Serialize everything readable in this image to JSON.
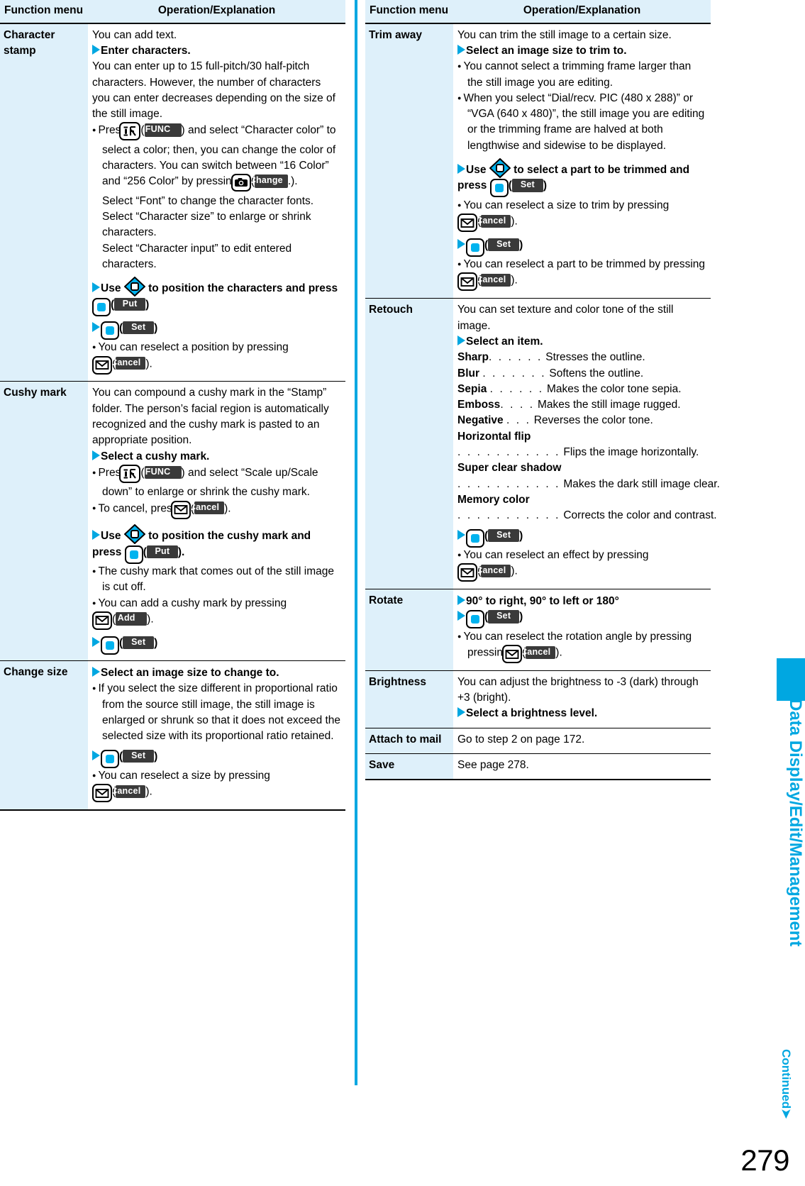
{
  "page": {
    "number": "279",
    "side_title": "Data Display/Edit/Management",
    "continued_label": "Continued",
    "continued_arrow": "➤",
    "accent_color": "#00a7e1",
    "header_bg": "#def0fa",
    "softkey_bg": "#3a3a3a"
  },
  "table_headers": {
    "function_menu": "Function menu",
    "operation": "Operation/Explanation"
  },
  "softkeys": {
    "func": "FUNC",
    "change": "Change",
    "put": "Put",
    "set": "Set",
    "cancel": "Cancel",
    "add": "Add"
  },
  "left_column": {
    "rows": [
      {
        "menu": "Character stamp",
        "menu_line1": "Character",
        "menu_line2": "stamp",
        "blocks": [
          {
            "type": "text",
            "text": "You can add text."
          },
          {
            "type": "step",
            "text": "Enter characters."
          },
          {
            "type": "text",
            "text": "You can enter up to 15 full-pitch/30 half-pitch characters. However, the number of characters you can enter decreases depending on the size of the still image."
          },
          {
            "type": "bullet-keys",
            "lead": "Press",
            "key": "func-key",
            "softkey": "FUNC",
            "text": "and select “Character color” to select a color; then, you can change the color of characters. You can switch between “16 Color” and “256 Color” by pressing",
            "key2": "camera-key",
            "softkey2": "Change",
            "tail": "."
          },
          {
            "type": "indent-text",
            "text": "Select “Font” to change the character fonts."
          },
          {
            "type": "indent-text",
            "text": "Select “Character size” to enlarge or shrink characters."
          },
          {
            "type": "indent-text",
            "text": "Select “Character input” to edit entered characters."
          },
          {
            "type": "step-keys",
            "lead": "Use",
            "key": "nav-key",
            "text": "to position the characters and press",
            "key2": "select-key",
            "softkey": "Put",
            "tail": ""
          },
          {
            "type": "step-key-only",
            "key": "select-key",
            "softkey": "Set"
          },
          {
            "type": "bullet-key-tail",
            "text": "You can reselect a position by pressing",
            "key": "mail-key",
            "softkey": "Cancel",
            "tail": "."
          }
        ]
      },
      {
        "menu": "Cushy mark",
        "blocks": [
          {
            "type": "text",
            "text": "You can compound a cushy mark in the “Stamp” folder. The person’s facial region is automatically recognized and the cushy mark is pasted to an appropriate position."
          },
          {
            "type": "step",
            "text": "Select a cushy mark."
          },
          {
            "type": "bullet-keys",
            "lead": "Press",
            "key": "func-key",
            "softkey": "FUNC",
            "text": "and select “Scale up/Scale down” to enlarge or shrink the cushy mark."
          },
          {
            "type": "bullet-key-tail",
            "text": "To cancel, press",
            "key": "mail-key",
            "softkey": "Cancel",
            "tail": ")."
          },
          {
            "type": "step-keys",
            "lead": "Use",
            "key": "nav-key",
            "text": "to position the cushy mark and press",
            "key2": "select-key",
            "softkey": "Put",
            "tail": "."
          },
          {
            "type": "bullet",
            "text": "The cushy mark that comes out of the still image is cut off."
          },
          {
            "type": "bullet-key-tail",
            "text": "You can add a cushy mark by pressing",
            "key": "mail-key",
            "softkey": "Add",
            "tail": "."
          },
          {
            "type": "step-key-only",
            "key": "select-key",
            "softkey": "Set"
          }
        ]
      },
      {
        "menu": "Change size",
        "blocks": [
          {
            "type": "step",
            "text": "Select an image size to change to."
          },
          {
            "type": "bullet",
            "text": "If you select the size different in proportional ratio from the source still image, the still image is enlarged or shrunk so that it does not exceed the selected size with its proportional ratio retained."
          },
          {
            "type": "step-key-only",
            "key": "select-key",
            "softkey": "Set"
          },
          {
            "type": "bullet-key-tail",
            "text": "You can reselect a size by pressing",
            "key": "mail-key",
            "softkey": "Cancel",
            "tail": "."
          }
        ]
      }
    ]
  },
  "right_column": {
    "rows": [
      {
        "menu": "Trim away",
        "blocks": [
          {
            "type": "text",
            "text": "You can trim the still image to a certain size."
          },
          {
            "type": "step",
            "text": "Select an image size to trim to."
          },
          {
            "type": "bullet",
            "text": "You cannot select a trimming frame larger than the still image you are editing."
          },
          {
            "type": "bullet",
            "text": "When you select “Dial/recv. PIC (480 x 288)” or “VGA (640 x 480)”, the still image you are editing or the trimming frame are halved at both lengthwise and sidewise to be displayed."
          },
          {
            "type": "step-keys",
            "lead": "Use",
            "key": "nav-key",
            "text": "to select a part to be trimmed and press",
            "key2": "select-key",
            "softkey": "Set",
            "tail": ""
          },
          {
            "type": "bullet-key-tail",
            "text": "You can reselect a size to trim by pressing",
            "key": "mail-key",
            "softkey": "Cancel",
            "tail": "."
          },
          {
            "type": "step-key-only",
            "key": "select-key",
            "softkey": "Set"
          },
          {
            "type": "bullet-key-tail",
            "text": "You can reselect a part to be trimmed by pressing",
            "key": "mail-key",
            "softkey": "Cancel",
            "tail": "."
          }
        ]
      },
      {
        "menu": "Retouch",
        "blocks": [
          {
            "type": "text",
            "text": "You can set texture and color tone of the still image."
          },
          {
            "type": "step",
            "text": "Select an item."
          },
          {
            "type": "deflist",
            "items": [
              {
                "term": "Sharp",
                "dots": ". . . . . .",
                "desc": "Stresses the outline.",
                "wrap": false
              },
              {
                "term": "Blur",
                "dots": ". . . . . . .",
                "desc": "Softens the outline.",
                "wrap": false
              },
              {
                "term": "Sepia",
                "dots": ". . . . . .",
                "desc": "Makes the color tone sepia.",
                "wrap": false
              },
              {
                "term": "Emboss",
                "dots": ". . . .",
                "desc": "Makes the still image rugged.",
                "wrap": false
              },
              {
                "term": "Negative",
                "dots": ". . .",
                "desc": "Reverses the color tone.",
                "wrap": false
              },
              {
                "term": "Horizontal flip",
                "dots": ". . . . . . . . . . .",
                "desc": "Flips the image horizontally.",
                "wrap": true
              },
              {
                "term": "Super clear shadow",
                "dots": ". . . . . . . . . . .",
                "desc": "Makes the dark still image clear.",
                "wrap": true
              },
              {
                "term": "Memory color",
                "dots": ". . . . . . . . . . .",
                "desc": "Corrects the color and contrast.",
                "wrap": true
              }
            ]
          },
          {
            "type": "step-key-only",
            "key": "select-key",
            "softkey": "Set"
          },
          {
            "type": "bullet-key-tail",
            "text": "You can reselect an effect by pressing",
            "key": "mail-key",
            "softkey": "Cancel",
            "tail": "."
          }
        ]
      },
      {
        "menu": "Rotate",
        "blocks": [
          {
            "type": "step",
            "text": "90° to right, 90° to left or 180°"
          },
          {
            "type": "step-key-only",
            "key": "select-key",
            "softkey": "Set"
          },
          {
            "type": "bullet-key-tail",
            "text": "You can reselect the rotation angle by pressing",
            "key": "mail-key",
            "softkey": "Cancel",
            "tail": "."
          }
        ]
      },
      {
        "menu": "Brightness",
        "blocks": [
          {
            "type": "text",
            "text": "You can adjust the brightness to -3 (dark) through +3 (bright)."
          },
          {
            "type": "step",
            "text": "Select a brightness level."
          }
        ]
      },
      {
        "menu": "Attach to mail",
        "blocks": [
          {
            "type": "text",
            "text": "Go to step 2 on page 172."
          }
        ]
      },
      {
        "menu": "Save",
        "blocks": [
          {
            "type": "text",
            "text": "See page 278."
          }
        ]
      }
    ]
  }
}
